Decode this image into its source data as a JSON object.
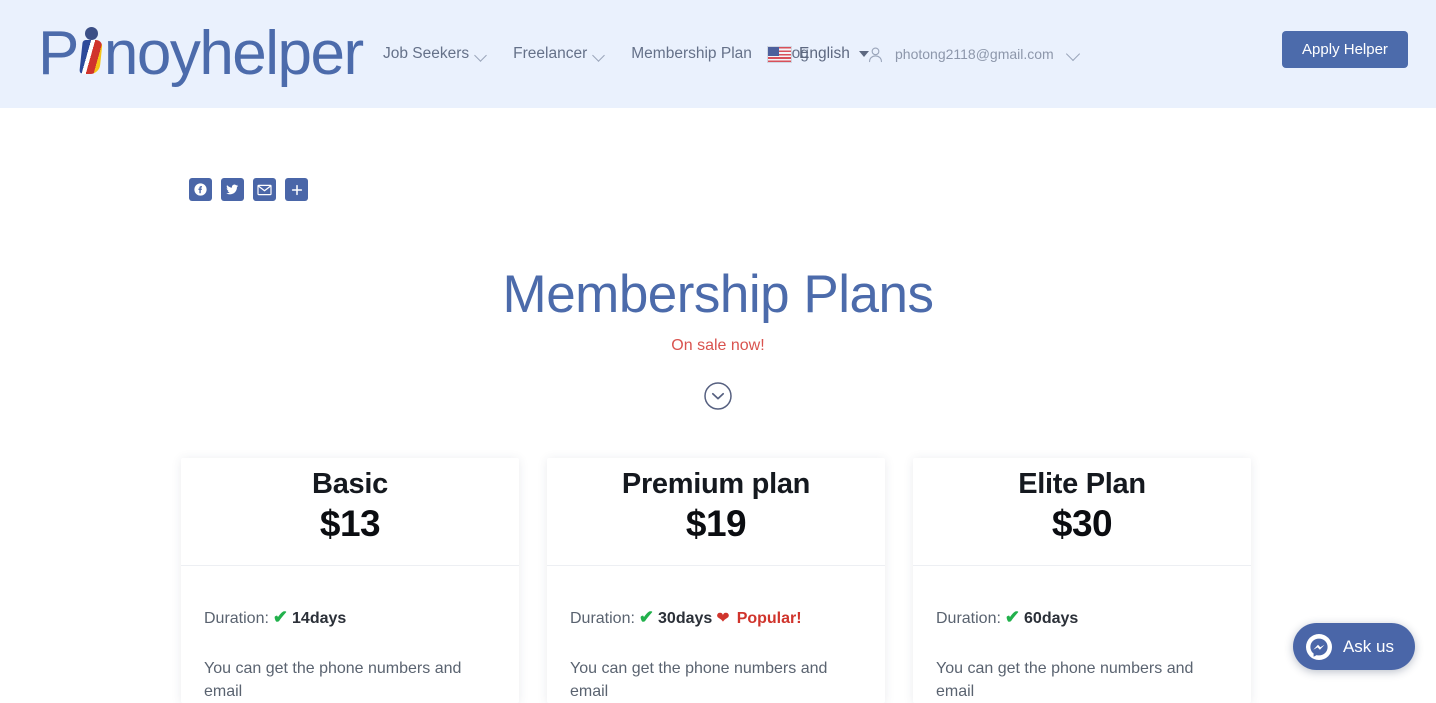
{
  "header": {
    "logo": {
      "prefix": "P",
      "i": "i",
      "suffix": "noyhelper",
      "alt": "Pinoyhelper"
    },
    "nav": [
      {
        "label": "Job Seekers",
        "has_caret": true
      },
      {
        "label": "Freelancer",
        "has_caret": true
      },
      {
        "label": "Membership Plan",
        "has_caret": false
      },
      {
        "label": "Blog",
        "has_caret": false
      }
    ],
    "language": {
      "label": "English",
      "flag": "us-flag-icon"
    },
    "account": {
      "email": "photong2118@gmail.com",
      "icon": "user-icon"
    },
    "apply_button": "Apply Helper",
    "background_color": "#eaf1fd",
    "brand_color": "#4c6bab"
  },
  "share": {
    "buttons": [
      {
        "name": "facebook",
        "label": "Facebook"
      },
      {
        "name": "twitter",
        "label": "Twitter"
      },
      {
        "name": "email",
        "label": "Email"
      },
      {
        "name": "more",
        "label": "Share more"
      }
    ]
  },
  "main": {
    "title": "Membership Plans",
    "subtitle": "On sale now!",
    "subtitle_color": "#d9534f",
    "scroll_cue": "chevron-down-circle-icon"
  },
  "plans": [
    {
      "name": "Basic",
      "price": "$13",
      "duration_label": "Duration:",
      "duration_value": "14days",
      "badge": "",
      "description": "You can get the phone numbers and email"
    },
    {
      "name": "Premium plan",
      "price": "$19",
      "duration_label": "Duration:",
      "duration_value": "30days",
      "badge": "Popular!",
      "description": "You can get the phone numbers and email"
    },
    {
      "name": "Elite Plan",
      "price": "$30",
      "duration_label": "Duration:",
      "duration_value": "60days",
      "badge": "",
      "description": "You can get the phone numbers and email"
    }
  ],
  "chat": {
    "label": "Ask us",
    "icon": "messenger-icon",
    "color": "#4a66a8"
  }
}
